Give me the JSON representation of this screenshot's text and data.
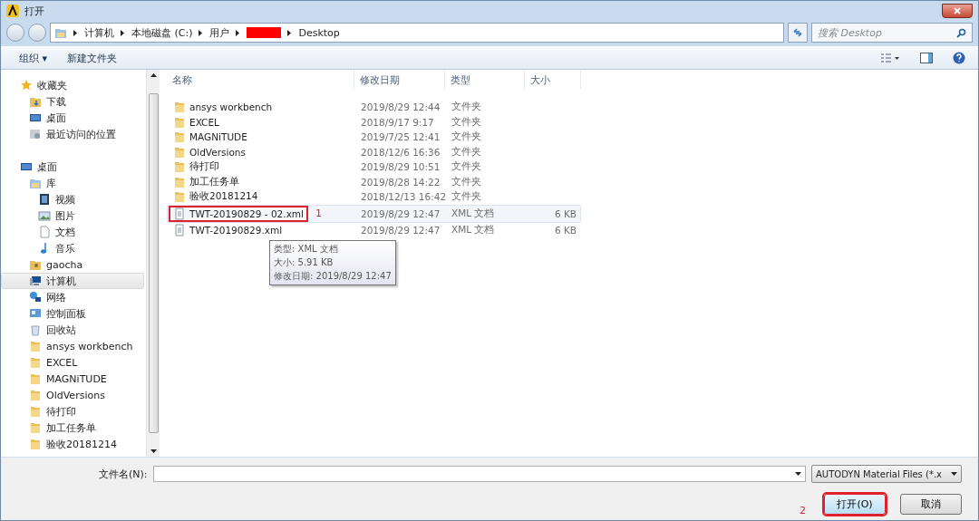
{
  "window": {
    "title": "打开"
  },
  "address": {
    "crumbs": [
      "计算机",
      "本地磁盘 (C:)",
      "用户",
      {
        "kind": "redaction"
      },
      "Desktop"
    ],
    "search_placeholder": "搜索 Desktop"
  },
  "toolbar": {
    "organize": "组织 ▾",
    "new_folder": "新建文件夹"
  },
  "sidebar": {
    "groups": [
      {
        "label": "收藏夹",
        "kind": "star",
        "selected": false,
        "children": [
          {
            "label": "下载",
            "kind": "download",
            "selected": false
          },
          {
            "label": "桌面",
            "kind": "desktop",
            "selected": false
          },
          {
            "label": "最近访问的位置",
            "kind": "recent",
            "selected": false
          }
        ]
      },
      {
        "label": "桌面",
        "kind": "desktop",
        "selected": false,
        "children": [
          {
            "label": "库",
            "kind": "library",
            "selected": false,
            "children": [
              {
                "label": "视频",
                "kind": "video",
                "selected": false
              },
              {
                "label": "图片",
                "kind": "picture",
                "selected": false
              },
              {
                "label": "文档",
                "kind": "document",
                "selected": false
              },
              {
                "label": "音乐",
                "kind": "music",
                "selected": false
              }
            ]
          },
          {
            "label": "gaocha",
            "kind": "user",
            "selected": false
          },
          {
            "label": "计算机",
            "kind": "computer",
            "selected": true
          },
          {
            "label": "网络",
            "kind": "network",
            "selected": false
          },
          {
            "label": "控制面板",
            "kind": "control",
            "selected": false
          },
          {
            "label": "回收站",
            "kind": "recycle",
            "selected": false
          },
          {
            "label": "ansys workbench",
            "kind": "folder",
            "selected": false
          },
          {
            "label": "EXCEL",
            "kind": "folder",
            "selected": false
          },
          {
            "label": "MAGNiTUDE",
            "kind": "folder",
            "selected": false
          },
          {
            "label": "OldVersions",
            "kind": "folder",
            "selected": false
          },
          {
            "label": "待打印",
            "kind": "folder",
            "selected": false
          },
          {
            "label": "加工任务单",
            "kind": "folder",
            "selected": false
          },
          {
            "label": "验收20181214",
            "kind": "folder",
            "selected": false
          }
        ]
      }
    ]
  },
  "table": {
    "columns": [
      "名称",
      "修改日期",
      "类型",
      "大小"
    ],
    "rows": [
      {
        "kind": "folder",
        "name": "ansys workbench",
        "date": "2019/8/29 12:44",
        "type": "文件夹",
        "selected": false
      },
      {
        "kind": "folder",
        "name": "EXCEL",
        "date": "2018/9/17 9:17",
        "type": "文件夹",
        "selected": false
      },
      {
        "kind": "folder",
        "name": "MAGNiTUDE",
        "date": "2019/7/25 12:41",
        "type": "文件夹",
        "selected": false
      },
      {
        "kind": "folder",
        "name": "OldVersions",
        "date": "2018/12/6 16:36",
        "type": "文件夹",
        "selected": false
      },
      {
        "kind": "folder",
        "name": "待打印",
        "date": "2019/8/29 10:51",
        "type": "文件夹",
        "selected": false
      },
      {
        "kind": "folder",
        "name": "加工任务单",
        "date": "2019/8/28 14:22",
        "type": "文件夹",
        "selected": false
      },
      {
        "kind": "folder",
        "name": "验收20181214",
        "date": "2018/12/13 16:42",
        "type": "文件夹",
        "selected": false
      },
      {
        "kind": "xml",
        "name": "TWT-20190829 - 02.xml",
        "date": "2019/8/29 12:47",
        "type": "XML 文档",
        "size": "6 KB",
        "selected": true,
        "callout": "1"
      },
      {
        "kind": "xml",
        "name": "TWT-20190829.xml",
        "date": "2019/8/29 12:47",
        "type": "XML 文档",
        "size": "6 KB",
        "selected": false
      }
    ]
  },
  "tooltip": {
    "lines": [
      "类型: XML 文档",
      "大小: 5.91 KB",
      "修改日期: 2019/8/29 12:47"
    ]
  },
  "footer": {
    "filename_label": "文件名(N):",
    "filter": "AUTODYN Material Files (*.x",
    "open_button": {
      "label": "打开(O)",
      "callout": "2"
    },
    "cancel_button": "取消"
  }
}
